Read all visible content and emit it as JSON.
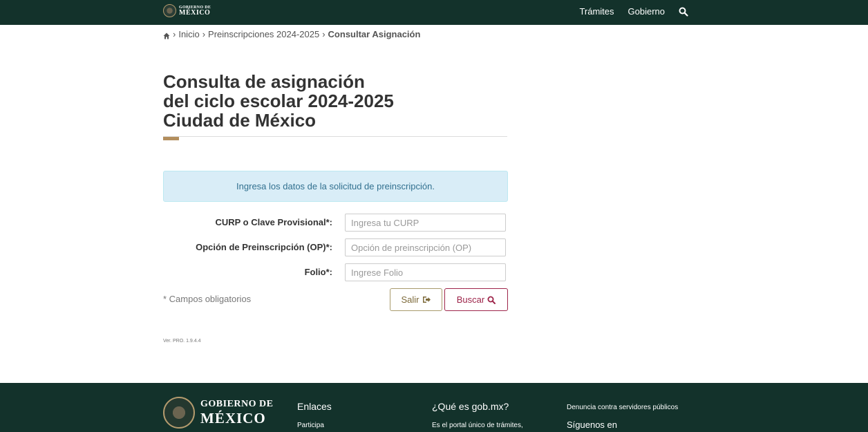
{
  "header": {
    "logo_line1": "GOBIERNO DE",
    "logo_line2": "MÉXICO",
    "nav": [
      "Trámites",
      "Gobierno"
    ],
    "colors": {
      "bar": "#13322b",
      "accent": "#b38e5d"
    }
  },
  "breadcrumb": {
    "items": [
      "Inicio",
      "Preinscripciones 2024-2025"
    ],
    "current": "Consultar Asignación"
  },
  "page": {
    "title_lines": [
      "Consulta de asignación",
      "del ciclo escolar 2024-2025",
      "Ciudad de México"
    ]
  },
  "alert": {
    "text": "Ingresa los datos de la solicitud de preinscripción."
  },
  "form": {
    "fields": [
      {
        "label": "CURP o Clave Provisional*:",
        "placeholder": "Ingresa tu CURP",
        "value": ""
      },
      {
        "label": "Opción de Preinscripción (OP)*:",
        "placeholder": "Opción de preinscripción (OP)",
        "value": ""
      },
      {
        "label": "Folio*:",
        "placeholder": "Ingrese Folio",
        "value": ""
      }
    ],
    "required_note": "* Campos obligatorios",
    "exit_label": "Salir",
    "search_label": "Buscar",
    "colors": {
      "search": "#9d2449",
      "exit": "#7d6a3a"
    }
  },
  "version": "Ver. PRO. 1.9.4.4",
  "footer": {
    "logo_line1": "GOBIERNO DE",
    "logo_line2": "MÉXICO",
    "links_heading": "Enlaces",
    "links_first": "Participa",
    "about_heading": "¿Qué es gob.mx?",
    "about_text": "Es el portal único de trámites,",
    "denuncia": "Denuncia contra servidores públicos",
    "follow": "Síguenos en"
  }
}
